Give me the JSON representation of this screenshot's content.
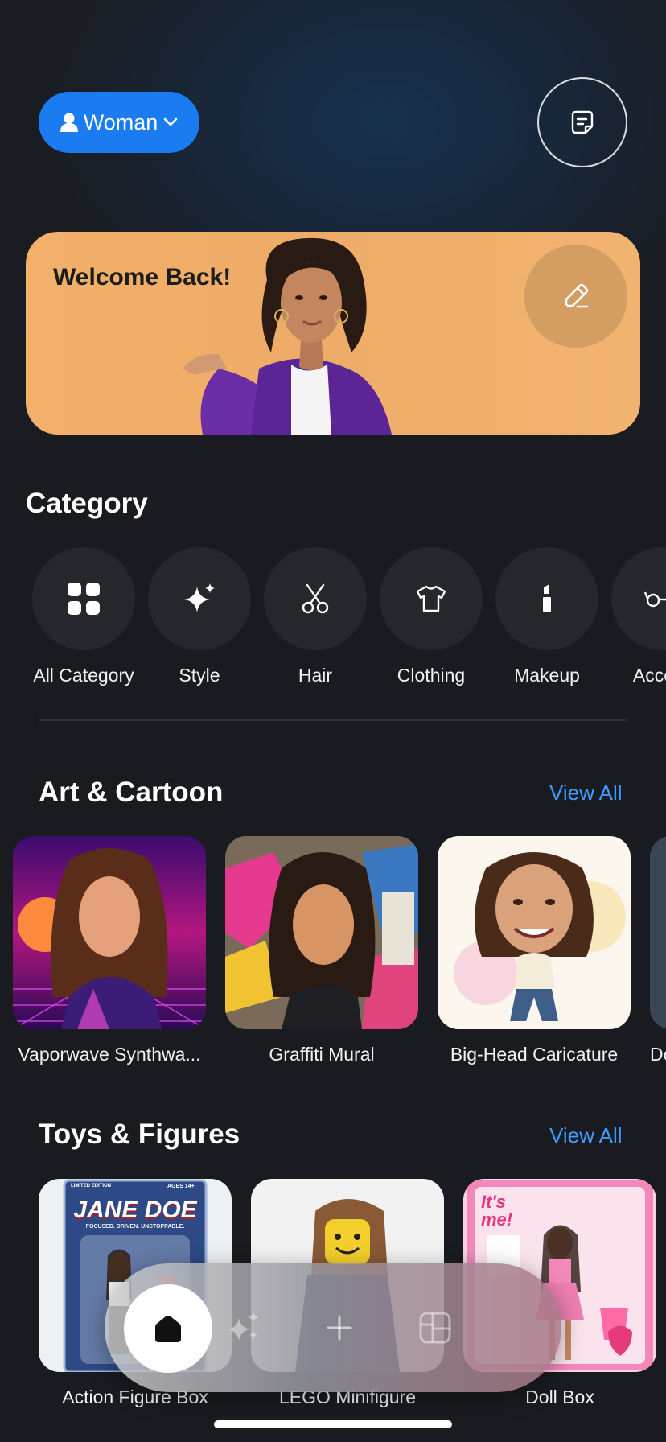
{
  "header": {
    "gender_label": "Woman",
    "gender_icon": "person-icon",
    "feedback_icon": "feedback-note-icon"
  },
  "banner": {
    "title": "Welcome Back!",
    "edit_icon": "pencil-icon"
  },
  "category": {
    "title": "Category",
    "items": [
      {
        "label": "All Category",
        "icon": "grid-icon"
      },
      {
        "label": "Style",
        "icon": "sparkle-icon"
      },
      {
        "label": "Hair",
        "icon": "scissors-icon"
      },
      {
        "label": "Clothing",
        "icon": "tshirt-icon"
      },
      {
        "label": "Makeup",
        "icon": "lipstick-icon"
      },
      {
        "label": "Access",
        "icon": "glasses-icon"
      }
    ]
  },
  "art_cartoon": {
    "title": "Art & Cartoon",
    "view_all": "View All",
    "items": [
      {
        "label": "Vaporwave Synthwa..."
      },
      {
        "label": "Graffiti Mural"
      },
      {
        "label": "Big-Head Caricature"
      },
      {
        "label": "Do"
      }
    ]
  },
  "toys_figures": {
    "title": "Toys & Figures",
    "view_all": "View All",
    "items": [
      {
        "label": "Action Figure Box",
        "box_title": "JANE DOE",
        "box_badge": "LIMITED EDITION",
        "box_age": "AGES 14+",
        "box_tagline": "FOCUSED. DRIVEN. UNSTOPPABLE."
      },
      {
        "label": "LEGO Minifigure"
      },
      {
        "label": "Doll Box",
        "box_title": "It's me!"
      }
    ]
  },
  "tabbar": {
    "tabs": [
      {
        "name": "home",
        "icon": "home-icon",
        "active": true
      },
      {
        "name": "ai",
        "icon": "sparkles-icon",
        "active": false
      },
      {
        "name": "create",
        "icon": "plus-icon",
        "active": false
      },
      {
        "name": "gallery",
        "icon": "layout-icon",
        "active": false
      }
    ]
  },
  "colors": {
    "accent": "#1a7cf0",
    "link": "#3f9bff",
    "background": "#191b20",
    "banner": "#f0ae6a"
  }
}
